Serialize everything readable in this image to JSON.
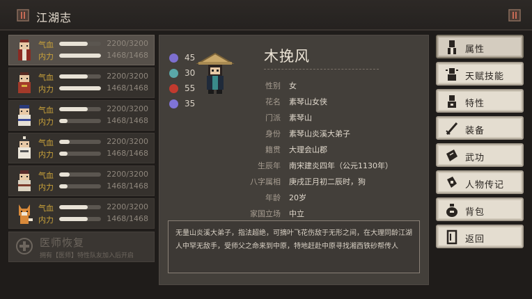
{
  "header": {
    "title": "江湖志"
  },
  "roster": {
    "members": [
      {
        "hp_label": "气血",
        "hp": "2200/3200",
        "hp_frac": 0.69,
        "mp_label": "内力",
        "mp": "1468/1468",
        "mp_frac": 1.0,
        "active": true
      },
      {
        "hp_label": "气血",
        "hp": "2200/3200",
        "hp_frac": 0.69,
        "mp_label": "内力",
        "mp": "1468/1468",
        "mp_frac": 1.0,
        "active": false
      },
      {
        "hp_label": "气血",
        "hp": "2200/3200",
        "hp_frac": 0.69,
        "mp_label": "内力",
        "mp": "1468/1468",
        "mp_frac": 0.2,
        "active": false
      },
      {
        "hp_label": "气血",
        "hp": "2200/3200",
        "hp_frac": 0.25,
        "mp_label": "内力",
        "mp": "1468/1468",
        "mp_frac": 0.2,
        "active": false
      },
      {
        "hp_label": "气血",
        "hp": "2200/3200",
        "hp_frac": 0.25,
        "mp_label": "内力",
        "mp": "1468/1468",
        "mp_frac": 0.2,
        "active": false
      },
      {
        "hp_label": "气血",
        "hp": "2200/3200",
        "hp_frac": 0.69,
        "mp_label": "内力",
        "mp": "1468/1468",
        "mp_frac": 0.69,
        "active": false
      }
    ],
    "heal": {
      "title": "医师恢复",
      "subtitle": "拥有【医师】特性队友加入后开启"
    }
  },
  "character": {
    "name": "木挽风",
    "attributes": [
      {
        "icon": "purple-orb-icon",
        "color": "#7d6fd0",
        "value": "45"
      },
      {
        "icon": "teal-orb-icon",
        "color": "#5aa7a8",
        "value": "30"
      },
      {
        "icon": "red-orb-icon",
        "color": "#c23a2e",
        "value": "55"
      },
      {
        "icon": "violet-orb-icon",
        "color": "#7f74d6",
        "value": "35"
      }
    ],
    "info": [
      {
        "key": "性别",
        "value": "女"
      },
      {
        "key": "花名",
        "value": "素琴山女侠"
      },
      {
        "key": "门派",
        "value": "素琴山"
      },
      {
        "key": "身份",
        "value": "素琴山炎溪大弟子"
      },
      {
        "key": "籍贯",
        "value": "大理会山郡"
      },
      {
        "key": "生辰年",
        "value": "南宋建炎四年（公元1130年）"
      },
      {
        "key": "八字属相",
        "value": "庚戌正月初二辰时，狗"
      },
      {
        "key": "年龄",
        "value": "20岁"
      },
      {
        "key": "家国立场",
        "value": "中立"
      }
    ],
    "bio": "无量山炎溪大弟子，指法超绝，可摘叶飞花伤敌于无形之间，在大理同龄江湖人中罕无敌手，受师父之命来到中原，特地赶赴中原寻找湘西铁砂帮传人"
  },
  "menu": [
    {
      "label": "属性",
      "icon": "person-icon",
      "selected": true
    },
    {
      "label": "天赋技能",
      "icon": "skill-icon",
      "selected": false
    },
    {
      "label": "特性",
      "icon": "trait-icon",
      "selected": false
    },
    {
      "label": "装备",
      "icon": "sword-icon",
      "selected": false
    },
    {
      "label": "武功",
      "icon": "manual-icon",
      "selected": false
    },
    {
      "label": "人物传记",
      "icon": "biography-icon",
      "selected": false
    },
    {
      "label": "背包",
      "icon": "bag-icon",
      "selected": false
    },
    {
      "label": "返回",
      "icon": "exit-door-icon",
      "selected": false
    }
  ]
}
